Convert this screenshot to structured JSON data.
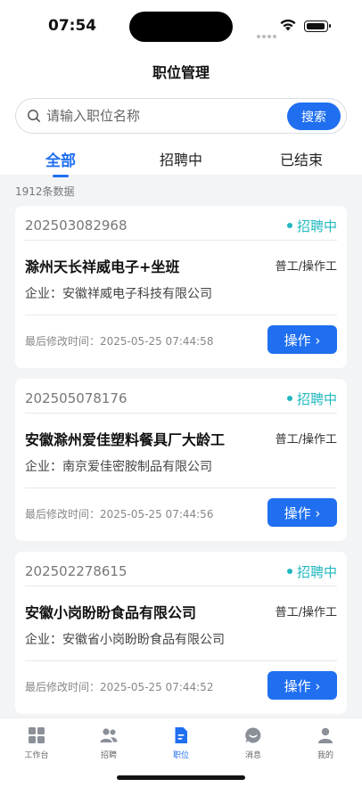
{
  "status_bar": {
    "time": "07:54"
  },
  "header": {
    "title": "职位管理"
  },
  "search": {
    "placeholder": "请输入职位名称",
    "value": "",
    "button_label": "搜索"
  },
  "tabs": [
    {
      "label": "全部",
      "active": true
    },
    {
      "label": "招聘中",
      "active": false
    },
    {
      "label": "已结束",
      "active": false
    }
  ],
  "result_count": "1912条数据",
  "cards": [
    {
      "code": "202503082968",
      "status": "招聘中",
      "title": "滁州天长祥威电子+坐班",
      "type": "普工/操作工",
      "company": "企业：安徽祥威电子科技有限公司",
      "modified": "最后修改时间：2025-05-25 07:44:58",
      "button_label": "操作 ›"
    },
    {
      "code": "202505078176",
      "status": "招聘中",
      "title": "安徽滁州爱佳塑料餐具厂大龄工",
      "type": "普工/操作工",
      "company": "企业：南京爱佳密胺制品有限公司",
      "modified": "最后修改时间：2025-05-25 07:44:56",
      "button_label": "操作 ›"
    },
    {
      "code": "202502278615",
      "status": "招聘中",
      "title": "安徽小岗盼盼食品有限公司",
      "type": "普工/操作工",
      "company": "企业：安徽省小岗盼盼食品有限公司",
      "modified": "最后修改时间：2025-05-25 07:44:52",
      "button_label": "操作 ›"
    }
  ],
  "tabbar": [
    {
      "label": "工作台",
      "icon": "grid-icon",
      "active": false
    },
    {
      "label": "招聘",
      "icon": "people-icon",
      "active": false
    },
    {
      "label": "职位",
      "icon": "document-icon",
      "active": true
    },
    {
      "label": "消息",
      "icon": "chat-icon",
      "active": false
    },
    {
      "label": "我的",
      "icon": "person-icon",
      "active": false
    }
  ],
  "colors": {
    "accent": "#1f6ff0",
    "status": "#20b8c0",
    "background": "#f3f4f6"
  }
}
